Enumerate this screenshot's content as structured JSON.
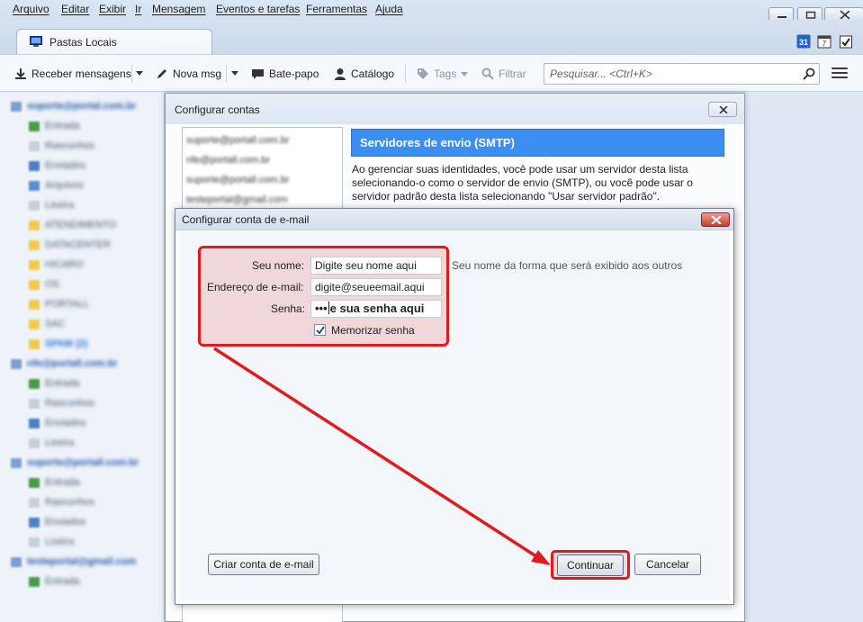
{
  "menu": [
    "Arquivo",
    "Editar",
    "Exibir",
    "Ir",
    "Mensagem",
    "Eventos e tarefas",
    "Ferramentas",
    "Ajuda"
  ],
  "tab": {
    "label": "Pastas Locais"
  },
  "toolbar": {
    "receive": "Receber mensagens",
    "new_msg": "Nova msg",
    "chat": "Bate-papo",
    "catalog": "Catálogo",
    "tags": "Tags",
    "filter": "Filtrar",
    "search_placeholder": "Pesquisar... <Ctrl+K>"
  },
  "folders": [
    {
      "label": "suporte@portal.com.br",
      "type": "account"
    },
    {
      "label": "Entrada",
      "type": "inbox"
    },
    {
      "label": "Rascunhos",
      "type": "drafts"
    },
    {
      "label": "Enviados",
      "type": "sent"
    },
    {
      "label": "Arquivos",
      "type": "archive"
    },
    {
      "label": "Lixeira",
      "type": "trash"
    },
    {
      "label": "ATENDIMENTO",
      "type": "folder"
    },
    {
      "label": "DATACENTER",
      "type": "folder"
    },
    {
      "label": "HICARO",
      "type": "folder"
    },
    {
      "label": "OS",
      "type": "folder"
    },
    {
      "label": "PORTALL",
      "type": "folder"
    },
    {
      "label": "SAC",
      "type": "folder"
    },
    {
      "label": "SPAM (2)",
      "type": "spam"
    },
    {
      "label": "nfe@portall.com.br",
      "type": "account"
    },
    {
      "label": "Entrada",
      "type": "inbox"
    },
    {
      "label": "Rascunhos",
      "type": "drafts"
    },
    {
      "label": "Enviados",
      "type": "sent"
    },
    {
      "label": "Lixeira",
      "type": "trash"
    },
    {
      "label": "suporte@portall.com.br",
      "type": "account"
    },
    {
      "label": "Entrada",
      "type": "inbox"
    },
    {
      "label": "Rascunhos",
      "type": "drafts"
    },
    {
      "label": "Enviados",
      "type": "sent"
    },
    {
      "label": "Lixeira",
      "type": "trash"
    },
    {
      "label": "testeportal@gmail.com",
      "type": "account"
    },
    {
      "label": "Entrada",
      "type": "inbox"
    }
  ],
  "config_window": {
    "title": "Configurar contas",
    "accounts": [
      "suporte@portall.com.br",
      "nfe@portall.com.br",
      "suporte@portall.com.br",
      "testeportal@gmail.com"
    ],
    "smtp_header": "Servidores de envio (SMTP)",
    "smtp_description": "Ao gerenciar suas identidades, você pode usar um servidor desta lista selecionando-o como o servidor de envio (SMTP), ou você pode usar o servidor padrão desta lista selecionando \"Usar servidor padrão\"."
  },
  "dialog": {
    "title": "Configurar conta de e-mail",
    "name_label": "Seu nome:",
    "name_value": "Digite seu nome aqui",
    "name_hint": "Seu nome da forma que será exibido aos outros",
    "email_label": "Endereço de e-mail:",
    "email_value": "digite@seueemail.aqui",
    "password_label": "Senha:",
    "password_dots": "•••",
    "password_value": "e sua senha aqui",
    "remember_label": "Memorizar senha",
    "remember_checked": true,
    "create_button": "Criar conta de e-mail",
    "continue_button": "Continuar",
    "cancel_button": "Cancelar"
  }
}
